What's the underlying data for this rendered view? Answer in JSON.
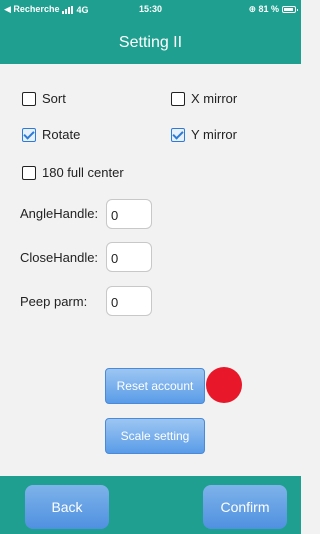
{
  "status_bar": {
    "carrier": "◀ Recherche",
    "network": "4G",
    "time": "15:30",
    "battery": "⊕ 81 %"
  },
  "header": {
    "title": "Setting II"
  },
  "options": {
    "sort": {
      "label": "Sort",
      "checked": false
    },
    "x_mirror": {
      "label": "X mirror",
      "checked": false
    },
    "rotate": {
      "label": "Rotate",
      "checked": true
    },
    "y_mirror": {
      "label": "Y mirror",
      "checked": true
    },
    "full_center": {
      "label": "180 full center",
      "checked": false
    }
  },
  "fields": {
    "angle_handle": {
      "label": "AngleHandle:",
      "value": "0"
    },
    "close_handle": {
      "label": "CloseHandle:",
      "value": "0"
    },
    "peep_parm": {
      "label": "Peep parm:",
      "value": "0"
    }
  },
  "buttons": {
    "reset_account": "Reset account",
    "scale_setting": "Scale setting",
    "back": "Back",
    "confirm": "Confirm"
  },
  "colors": {
    "header_bg": "#1e9f8f",
    "button_blue": "#5a9ce8",
    "marker_red": "#e8182a"
  }
}
